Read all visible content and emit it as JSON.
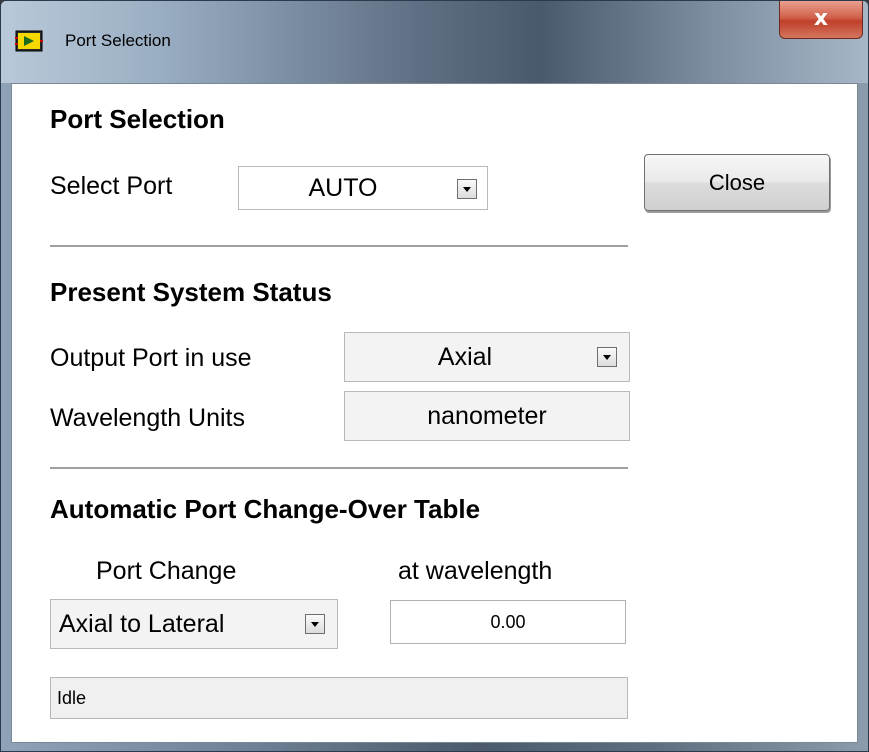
{
  "window": {
    "title": "Port Selection",
    "close_glyph": "x"
  },
  "port_selection": {
    "heading": "Port Selection",
    "select_port_label": "Select Port",
    "select_port_value": "AUTO",
    "close_button": "Close"
  },
  "status": {
    "heading": "Present System Status",
    "output_port_label": "Output Port in use",
    "output_port_value": "Axial",
    "wavelength_units_label": "Wavelength Units",
    "wavelength_units_value": "nanometer"
  },
  "changeover": {
    "heading": "Automatic Port Change-Over Table",
    "port_change_header": "Port Change",
    "wavelength_header": "at wavelength",
    "port_change_value": "Axial to Lateral",
    "wavelength_value": "0.00"
  },
  "statusbar": {
    "text": "Idle"
  },
  "icons": {
    "app": "labview-vi-icon",
    "dropdown": "chevron-down-icon",
    "close": "close-icon"
  }
}
